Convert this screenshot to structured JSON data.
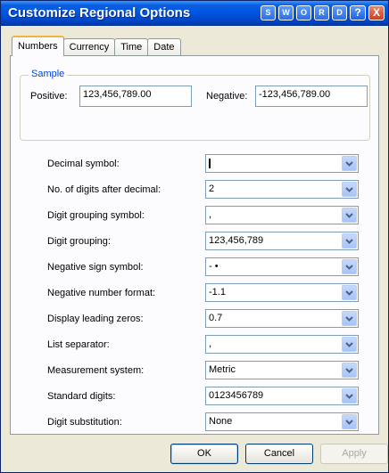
{
  "window": {
    "title": "Customize Regional Options",
    "title_buttons": [
      "S",
      "W",
      "O",
      "R",
      "D",
      "?",
      "X"
    ]
  },
  "tabs": [
    {
      "label": "Numbers",
      "active": true
    },
    {
      "label": "Currency",
      "active": false
    },
    {
      "label": "Time",
      "active": false
    },
    {
      "label": "Date",
      "active": false
    }
  ],
  "sample": {
    "legend": "Sample",
    "positive_label": "Positive:",
    "positive_value": "123,456,789.00",
    "negative_label": "Negative:",
    "negative_value": "-123,456,789.00"
  },
  "settings": [
    {
      "label": "Decimal symbol:",
      "value": ""
    },
    {
      "label": "No. of digits after decimal:",
      "value": "2"
    },
    {
      "label": "Digit grouping symbol:",
      "value": ","
    },
    {
      "label": "Digit grouping:",
      "value": "123,456,789"
    },
    {
      "label": "Negative sign symbol:",
      "value": "- •"
    },
    {
      "label": "Negative number format:",
      "value": "-1.1"
    },
    {
      "label": "Display leading zeros:",
      "value": "0.7"
    },
    {
      "label": "List separator:",
      "value": ","
    },
    {
      "label": "Measurement system:",
      "value": "Metric"
    },
    {
      "label": "Standard digits:",
      "value": "0123456789"
    },
    {
      "label": "Digit substitution:",
      "value": "None"
    }
  ],
  "buttons": {
    "ok": "OK",
    "cancel": "Cancel",
    "apply": "Apply"
  },
  "colors": {
    "titlebar": "#0054e3",
    "tab_highlight": "#f7b23b",
    "group_legend": "#0046d5",
    "dialog_bg": "#ece9d8"
  }
}
